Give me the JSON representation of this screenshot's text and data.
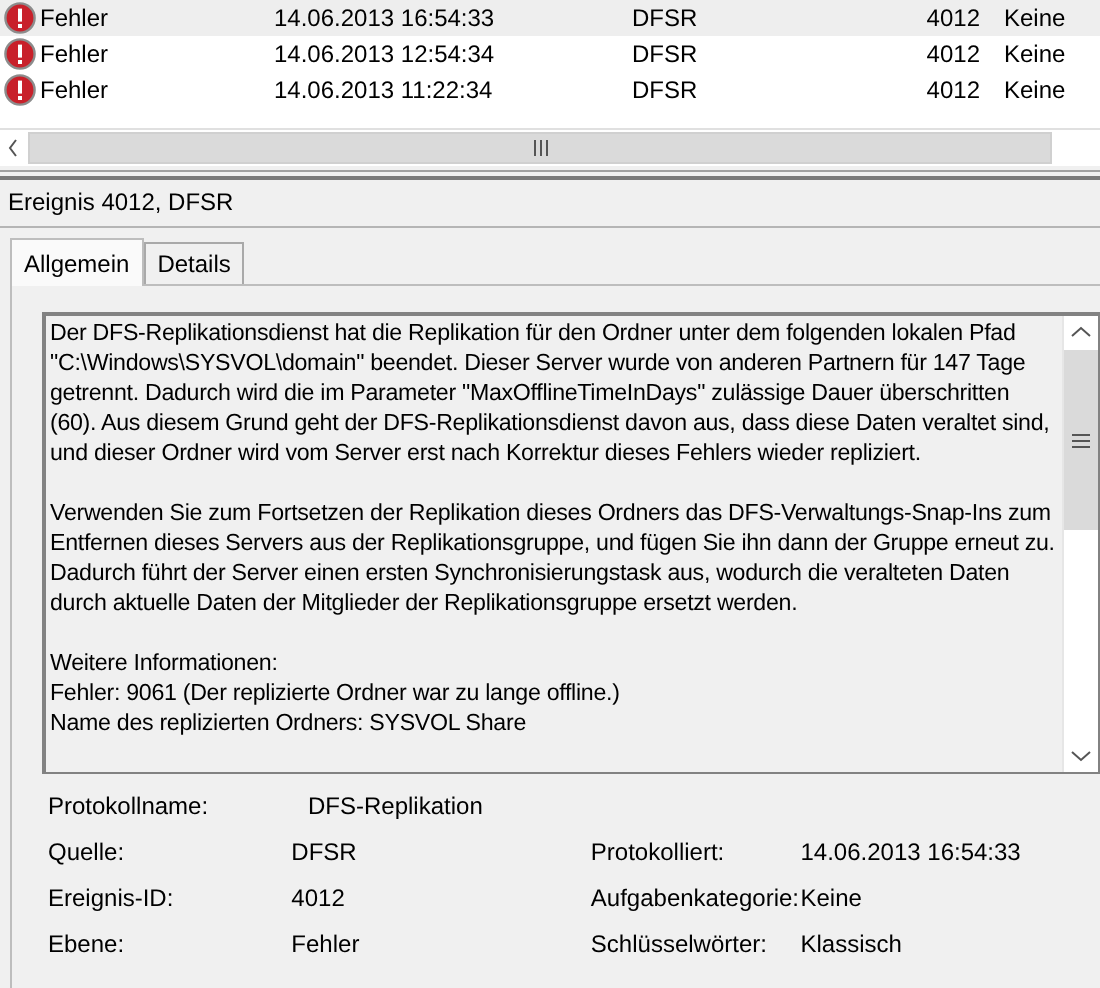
{
  "events": {
    "rows": [
      {
        "level": "Fehler",
        "date": "14.06.2013 16:54:33",
        "source": "DFSR",
        "id": "4012",
        "category": "Keine",
        "selected": true
      },
      {
        "level": "Fehler",
        "date": "14.06.2013 12:54:34",
        "source": "DFSR",
        "id": "4012",
        "category": "Keine",
        "selected": false
      },
      {
        "level": "Fehler",
        "date": "14.06.2013 11:22:34",
        "source": "DFSR",
        "id": "4012",
        "category": "Keine",
        "selected": false
      }
    ]
  },
  "detail_title": "Ereignis 4012, DFSR",
  "tabs": [
    {
      "label": "Allgemein",
      "selected": true
    },
    {
      "label": "Details",
      "selected": false
    }
  ],
  "description": [
    "Der DFS-Replikationsdienst hat die Replikation für den Ordner unter dem folgenden lokalen Pfad \"C:\\Windows\\SYSVOL\\domain\" beendet. Dieser Server wurde von anderen Partnern für 147 Tage getrennt. Dadurch wird die im Parameter \"MaxOfflineTimeInDays\" zulässige Dauer überschritten (60). Aus diesem Grund geht der DFS-Replikationsdienst davon aus, dass diese Daten veraltet sind, und dieser Ordner wird vom Server erst nach Korrektur dieses Fehlers wieder repliziert.",
    "Verwenden Sie zum Fortsetzen der Replikation dieses Ordners das DFS-Verwaltungs-Snap-Ins zum Entfernen dieses Servers aus der Replikationsgruppe, und fügen Sie ihn dann der Gruppe erneut zu. Dadurch führt der Server einen ersten Synchronisierungstask aus, wodurch die veralteten Daten durch aktuelle Daten der Mitglieder der Replikationsgruppe ersetzt werden.",
    "Weitere Informationen:\nFehler: 9061 (Der replizierte Ordner war zu lange offline.)\nName des replizierten Ordners: SYSVOL Share"
  ],
  "fields": [
    {
      "label": "Protokollname:",
      "value": "DFS-Replikation"
    },
    {
      "label": "Quelle:",
      "value": "DFSR",
      "label_2": "Protokolliert:",
      "value_2": "14.06.2013 16:54:33"
    },
    {
      "label": "Ereignis-ID:",
      "value": "4012",
      "label_2": "Aufgabenkategorie:",
      "value_2": "Keine"
    },
    {
      "label": "Ebene:",
      "value": "Fehler",
      "label_2": "Schlüsselwörter:",
      "value_2": "Klassisch"
    }
  ]
}
